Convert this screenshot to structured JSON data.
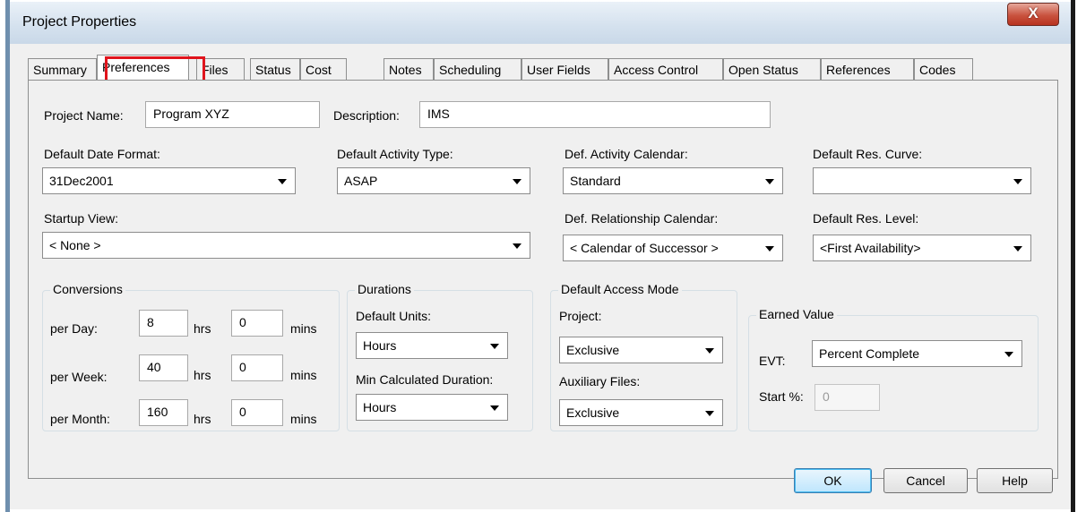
{
  "window": {
    "title": "Project Properties",
    "close_glyph": "X"
  },
  "tabs": [
    {
      "label": "Summary"
    },
    {
      "label": "Preferences"
    },
    {
      "label": "Files"
    },
    {
      "label": "Status"
    },
    {
      "label": "Cost"
    },
    {
      "label": "Notes"
    },
    {
      "label": "Scheduling"
    },
    {
      "label": "User Fields"
    },
    {
      "label": "Access Control"
    },
    {
      "label": "Open Status"
    },
    {
      "label": "References"
    },
    {
      "label": "Codes"
    }
  ],
  "active_tab": "Preferences",
  "highlight_color": "#e0141c",
  "project": {
    "name_label": "Project Name:",
    "name_value": "Program XYZ",
    "description_label": "Description:",
    "description_value": "IMS"
  },
  "defaults": {
    "date_format_label": "Default Date Format:",
    "date_format_value": "31Dec2001",
    "activity_type_label": "Default Activity Type:",
    "activity_type_value": "ASAP",
    "activity_calendar_label": "Def. Activity Calendar:",
    "activity_calendar_value": "Standard",
    "res_curve_label": "Default Res. Curve:",
    "res_curve_value": "",
    "startup_view_label": "Startup View:",
    "startup_view_value": "< None >",
    "relationship_calendar_label": "Def. Relationship Calendar:",
    "relationship_calendar_value": "< Calendar of Successor >",
    "res_level_label": "Default Res. Level:",
    "res_level_value": "<First Availability>"
  },
  "conversions": {
    "title": "Conversions",
    "rows": [
      {
        "label": "per Day:",
        "hrs": "8",
        "mins": "0"
      },
      {
        "label": "per Week:",
        "hrs": "40",
        "mins": "0"
      },
      {
        "label": "per Month:",
        "hrs": "160",
        "mins": "0"
      }
    ],
    "hrs_unit": "hrs",
    "mins_unit": "mins"
  },
  "durations": {
    "title": "Durations",
    "default_units_label": "Default Units:",
    "default_units_value": "Hours",
    "min_calc_label": "Min Calculated Duration:",
    "min_calc_value": "Hours"
  },
  "access_mode": {
    "title": "Default Access Mode",
    "project_label": "Project:",
    "project_value": "Exclusive",
    "aux_label": "Auxiliary Files:",
    "aux_value": "Exclusive"
  },
  "earned_value": {
    "title": "Earned Value",
    "evt_label": "EVT:",
    "evt_value": "Percent Complete",
    "start_label": "Start %:",
    "start_value": "0"
  },
  "buttons": {
    "ok": "OK",
    "cancel": "Cancel",
    "help": "Help"
  }
}
